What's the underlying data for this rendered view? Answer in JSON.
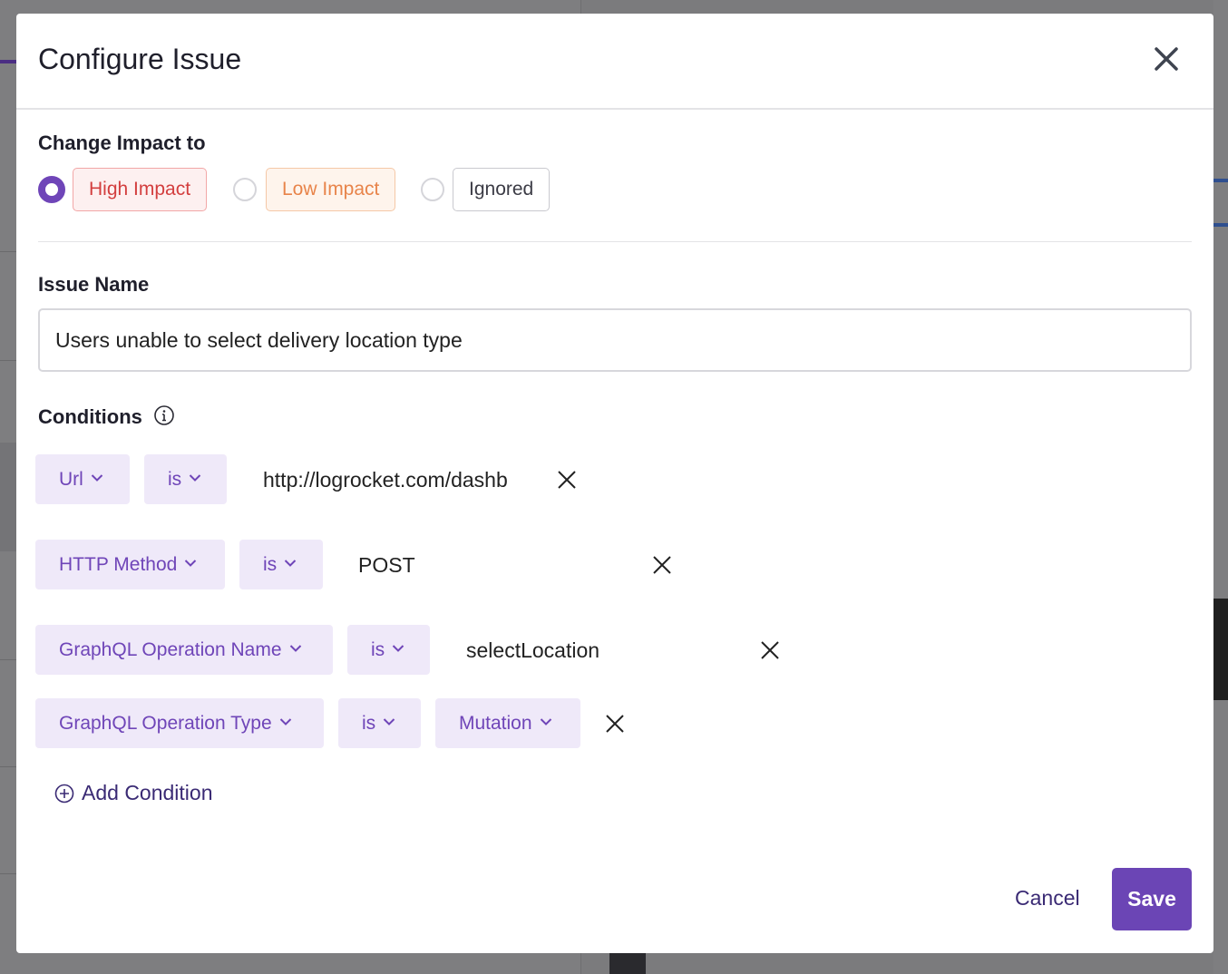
{
  "modal": {
    "title": "Configure Issue",
    "close_icon": "close-icon"
  },
  "impact": {
    "label": "Change Impact to",
    "selected": "High Impact",
    "options": [
      "High Impact",
      "Low Impact",
      "Ignored"
    ]
  },
  "issue_name": {
    "label": "Issue Name",
    "value": "Users unable to select delivery location type"
  },
  "conditions": {
    "label": "Conditions",
    "info_icon": "info-icon",
    "rows": [
      {
        "field": "Url",
        "operator": "is",
        "value": "http://logrocket.com/dashb"
      },
      {
        "field": "HTTP Method",
        "operator": "is",
        "value": "POST"
      },
      {
        "field": "GraphQL Operation Name",
        "operator": "is",
        "value": "selectLocation"
      },
      {
        "field": "GraphQL Operation Type",
        "operator": "is",
        "value": "Mutation"
      }
    ],
    "add_label": "Add Condition"
  },
  "footer": {
    "cancel_label": "Cancel",
    "save_label": "Save"
  },
  "colors": {
    "accent": "#6b45b5",
    "high_impact": "#d33e3e",
    "low_impact": "#e8844a"
  }
}
